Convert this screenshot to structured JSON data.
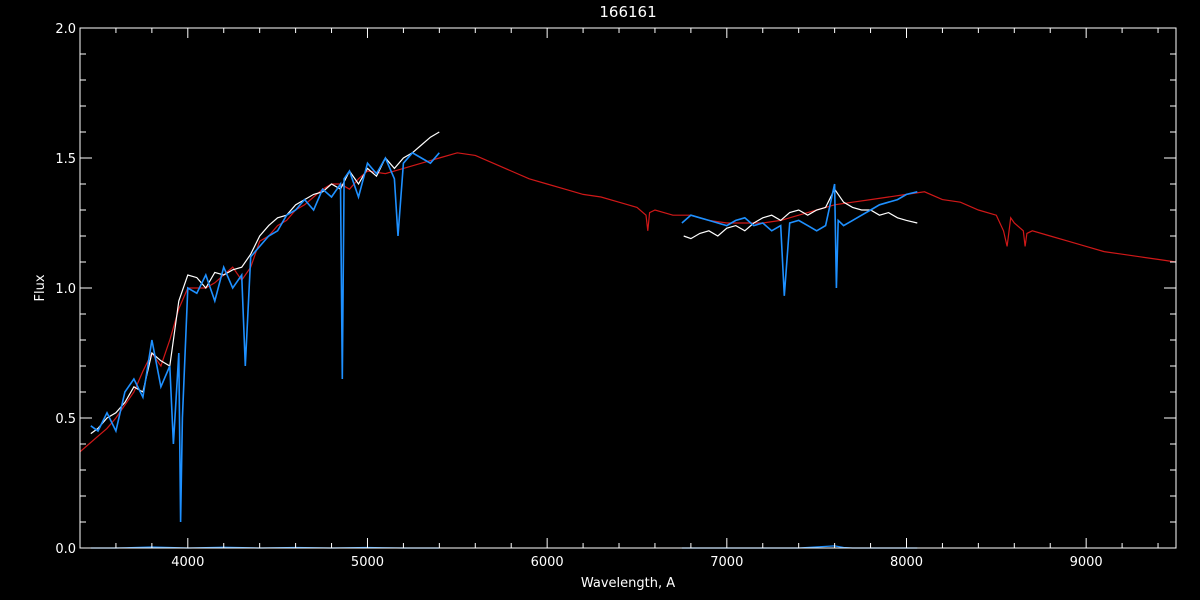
{
  "chart_data": {
    "type": "line",
    "title": "166161",
    "xlabel": "Wavelength, A",
    "ylabel": "Flux",
    "xlim": [
      3400,
      9500
    ],
    "ylim": [
      0.0,
      2.0
    ],
    "grid": false,
    "x_ticks": [
      4000,
      5000,
      6000,
      7000,
      8000,
      9000
    ],
    "y_ticks": [
      "0.0",
      "0.5",
      "1.0",
      "1.5",
      "2.0"
    ],
    "colors": {
      "background": "#000000",
      "axes": "#ffffff",
      "observed": "#ffffff",
      "fit": "#1e90ff",
      "model": "#d01818",
      "error": "#1e90ff"
    },
    "series": [
      {
        "key": "model",
        "x": [
          3400,
          3450,
          3500,
          3550,
          3600,
          3650,
          3700,
          3750,
          3800,
          3850,
          3900,
          3950,
          4000,
          4050,
          4100,
          4150,
          4200,
          4250,
          4300,
          4350,
          4400,
          4450,
          4500,
          4550,
          4600,
          4650,
          4700,
          4750,
          4800,
          4850,
          4900,
          4950,
          5000,
          5100,
          5200,
          5300,
          5400,
          5500,
          5600,
          5700,
          5800,
          5900,
          6000,
          6100,
          6200,
          6300,
          6400,
          6500,
          6550,
          6560,
          6570,
          6600,
          6700,
          6800,
          6900,
          7000,
          7100,
          7200,
          7300,
          7400,
          7500,
          7600,
          7700,
          7800,
          7900,
          8000,
          8100,
          8200,
          8300,
          8400,
          8500,
          8540,
          8560,
          8580,
          8600,
          8650,
          8660,
          8670,
          8700,
          8800,
          8900,
          9000,
          9100,
          9200,
          9300,
          9400,
          9500
        ],
        "y": [
          0.37,
          0.4,
          0.43,
          0.46,
          0.5,
          0.55,
          0.6,
          0.68,
          0.75,
          0.7,
          0.8,
          0.92,
          1.0,
          1.0,
          1.0,
          1.02,
          1.05,
          1.08,
          1.03,
          1.08,
          1.18,
          1.2,
          1.24,
          1.26,
          1.3,
          1.32,
          1.35,
          1.38,
          1.4,
          1.4,
          1.38,
          1.42,
          1.45,
          1.44,
          1.46,
          1.48,
          1.5,
          1.52,
          1.51,
          1.48,
          1.45,
          1.42,
          1.4,
          1.38,
          1.36,
          1.35,
          1.33,
          1.31,
          1.28,
          1.22,
          1.29,
          1.3,
          1.28,
          1.28,
          1.26,
          1.25,
          1.25,
          1.25,
          1.26,
          1.28,
          1.3,
          1.32,
          1.33,
          1.34,
          1.35,
          1.36,
          1.37,
          1.34,
          1.33,
          1.3,
          1.28,
          1.22,
          1.16,
          1.27,
          1.25,
          1.22,
          1.16,
          1.21,
          1.22,
          1.2,
          1.18,
          1.16,
          1.14,
          1.13,
          1.12,
          1.11,
          1.1
        ]
      },
      {
        "key": "observed",
        "x": [
          3460,
          3500,
          3550,
          3600,
          3650,
          3700,
          3750,
          3800,
          3850,
          3900,
          3950,
          4000,
          4050,
          4100,
          4150,
          4200,
          4250,
          4300,
          4350,
          4400,
          4450,
          4500,
          4550,
          4600,
          4650,
          4700,
          4750,
          4800,
          4850,
          4900,
          4950,
          5000,
          5050,
          5100,
          5150,
          5200,
          5250,
          5300,
          5350,
          5400,
          6760,
          6800,
          6850,
          6900,
          6950,
          7000,
          7050,
          7100,
          7150,
          7200,
          7250,
          7300,
          7350,
          7400,
          7450,
          7500,
          7550,
          7600,
          7650,
          7700,
          7750,
          7800,
          7850,
          7900,
          7950,
          8000,
          8060
        ],
        "y": [
          0.44,
          0.46,
          0.5,
          0.52,
          0.56,
          0.62,
          0.6,
          0.75,
          0.72,
          0.7,
          0.95,
          1.05,
          1.04,
          1.0,
          1.06,
          1.05,
          1.07,
          1.08,
          1.13,
          1.2,
          1.24,
          1.27,
          1.28,
          1.32,
          1.34,
          1.36,
          1.37,
          1.4,
          1.38,
          1.45,
          1.4,
          1.46,
          1.43,
          1.5,
          1.46,
          1.5,
          1.52,
          1.55,
          1.58,
          1.6,
          1.2,
          1.19,
          1.21,
          1.22,
          1.2,
          1.23,
          1.24,
          1.22,
          1.25,
          1.27,
          1.28,
          1.26,
          1.29,
          1.3,
          1.28,
          1.3,
          1.31,
          1.38,
          1.33,
          1.31,
          1.3,
          1.3,
          1.28,
          1.29,
          1.27,
          1.26,
          1.25
        ]
      },
      {
        "key": "fit",
        "x": [
          3460,
          3500,
          3550,
          3600,
          3650,
          3700,
          3750,
          3800,
          3850,
          3900,
          3920,
          3950,
          3960,
          3970,
          4000,
          4050,
          4100,
          4150,
          4200,
          4250,
          4300,
          4320,
          4350,
          4400,
          4450,
          4500,
          4550,
          4600,
          4650,
          4700,
          4750,
          4800,
          4850,
          4860,
          4870,
          4900,
          4950,
          5000,
          5050,
          5100,
          5150,
          5170,
          5200,
          5250,
          5300,
          5350,
          5400,
          6750,
          6800,
          6850,
          6900,
          6950,
          7000,
          7050,
          7100,
          7150,
          7200,
          7250,
          7300,
          7320,
          7350,
          7400,
          7450,
          7500,
          7550,
          7600,
          7610,
          7620,
          7650,
          7700,
          7750,
          7800,
          7850,
          7900,
          7950,
          8000,
          8060
        ],
        "y": [
          0.47,
          0.45,
          0.52,
          0.45,
          0.6,
          0.65,
          0.58,
          0.8,
          0.62,
          0.7,
          0.4,
          0.75,
          0.1,
          0.5,
          1.0,
          0.98,
          1.05,
          0.95,
          1.08,
          1.0,
          1.05,
          0.7,
          1.12,
          1.16,
          1.2,
          1.22,
          1.28,
          1.3,
          1.34,
          1.3,
          1.38,
          1.35,
          1.4,
          0.65,
          1.42,
          1.45,
          1.35,
          1.48,
          1.44,
          1.5,
          1.42,
          1.2,
          1.48,
          1.52,
          1.5,
          1.48,
          1.52,
          1.25,
          1.28,
          1.27,
          1.26,
          1.25,
          1.24,
          1.26,
          1.27,
          1.24,
          1.25,
          1.22,
          1.24,
          0.97,
          1.25,
          1.26,
          1.24,
          1.22,
          1.24,
          1.4,
          1.0,
          1.26,
          1.24,
          1.26,
          1.28,
          1.3,
          1.32,
          1.33,
          1.34,
          1.36,
          1.37
        ]
      },
      {
        "key": "error",
        "x": [
          3460,
          3600,
          3800,
          4000,
          4200,
          4400,
          4600,
          4800,
          5000,
          5200,
          5400,
          6750,
          7000,
          7200,
          7400,
          7600,
          7650,
          7700,
          8060
        ],
        "y": [
          0.0,
          0.0,
          0.004,
          0.0,
          0.003,
          0.0,
          0.002,
          0.0,
          0.002,
          0.0,
          0.0,
          0.0,
          0.0,
          0.0,
          0.0,
          0.008,
          0.002,
          0.0,
          0.0
        ]
      }
    ]
  }
}
